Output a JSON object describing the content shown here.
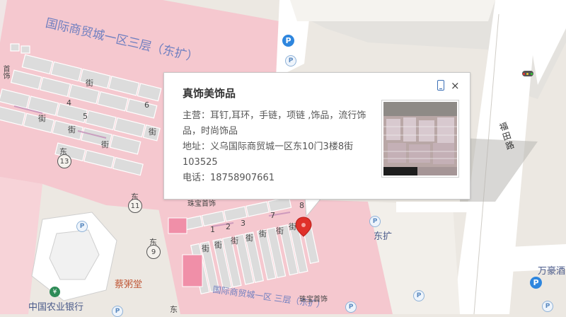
{
  "map": {
    "mall_title_top": "国际商贸城一区三层（东扩）",
    "mall_title_bottom": "国际商贸城一区 三层（东扩）",
    "street_labels": [
      "街",
      "街",
      "街",
      "街",
      "街",
      "街",
      "街",
      "街",
      "街",
      "街",
      "街",
      "街"
    ],
    "block_numbers": [
      "1",
      "2",
      "3",
      "4",
      "5",
      "6",
      "7",
      "8"
    ],
    "east_badges": [
      {
        "text": "东",
        "num": "13"
      },
      {
        "text": "东",
        "num": "11"
      },
      {
        "text": "东",
        "num": "9"
      },
      {
        "text": "东",
        "num": ""
      }
    ],
    "shop_labels": [
      "珠宝首饰",
      "珠宝首饰",
      "首饰"
    ],
    "road_label": "福田路",
    "poi_bank": "中国农业银行",
    "poi_restaurant": "蔡粥堂",
    "poi_east_ext": "东扩",
    "poi_hotel": "万豪酒",
    "parking_symbol": "P"
  },
  "popup": {
    "title": "真饰美饰品",
    "business_label": "主营：",
    "business_value": "耳钉,耳环，手链，项链 ,饰品，流行饰品，时尚饰品",
    "address_label": "地址：",
    "address_value": "义乌国际商贸城一区东10门3楼8街103525",
    "phone_label": "电话：",
    "phone_value": "18758907661",
    "close_symbol": "×"
  },
  "marker": {
    "color": "#e0302a"
  },
  "colors": {
    "mall_fill": "#f5c8cf",
    "stall_fill": "#dcdcdc",
    "road": "#ffffff",
    "ground": "#ece8e2",
    "parking": "#2e86de"
  }
}
